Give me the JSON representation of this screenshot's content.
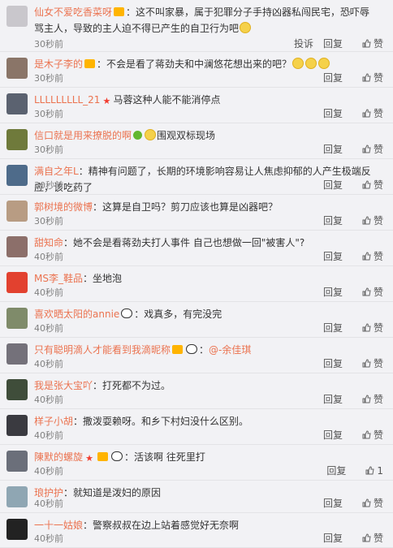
{
  "actions": {
    "report": "投诉",
    "reply": "回复",
    "like": "赞"
  },
  "comments": [
    {
      "name": "仙女不爱吃香菜呀",
      "badges": [
        "vip"
      ],
      "text": "：这不叫家暴，属于犯罪分子手持凶器私闯民宅，恐吓辱骂主人，导致的主人迫不得已产生的自卫行为吧",
      "time": "30秒前",
      "avatar_color": "#c9c7cc"
    },
    {
      "name": "是木子李的",
      "badges": [
        "vip"
      ],
      "text": "：不会是看了蒋劲夫和中澜悠花想出来的吧？",
      "time": "30秒前",
      "avatar_color": "#8a7568"
    },
    {
      "name": "LLLLLLLLL_21",
      "badges": [
        "red"
      ],
      "text": "马蓉这种人能不能消停点",
      "time": "30秒前",
      "avatar_color": "#5b6270"
    },
    {
      "name": "信口就是用来撩脱的啊",
      "badges": [
        "green"
      ],
      "text": "围观双标现场",
      "time": "30秒前",
      "avatar_color": "#6f7a3b"
    },
    {
      "name": "满自之年L",
      "badges": [],
      "text": "：精神有问题了，长期的环境影响容易让人焦虑抑郁的人产生极端反应，该吃药了",
      "time": "30秒前",
      "avatar_color": "#4e6b8a"
    },
    {
      "name": "郭树境的微博",
      "badges": [],
      "text": "：这算是自卫吗？剪刀应该也算是凶器吧？",
      "time": "30秒前",
      "avatar_color": "#b89c83"
    },
    {
      "name": "甜知命",
      "badges": [],
      "text": "：她不会是看蒋劲夫打人事件 自己也想做一回\"被害人\"?",
      "time": "40秒前",
      "avatar_color": "#8c6f6a"
    },
    {
      "name": "MS李_鞋品",
      "badges": [],
      "text": "：坐地泡",
      "time": "40秒前",
      "avatar_color": "#e2412f"
    },
    {
      "name": "喜欢晒太阳的annie",
      "badges": [
        "panda"
      ],
      "text": "：戏真多，有完没完",
      "time": "40秒前",
      "avatar_color": "#7f8b6a"
    },
    {
      "name": "只有聪明滴人才能看到我滴昵称",
      "badges": [
        "vip",
        "panda"
      ],
      "text": "：",
      "mention": "@-余佳琪",
      "time": "40秒前",
      "avatar_color": "#74717a"
    },
    {
      "name": "我是张大宝吖",
      "badges": [],
      "text": "：打死都不为过。",
      "time": "40秒前",
      "avatar_color": "#3f4d3a"
    },
    {
      "name": "样子小胡",
      "badges": [],
      "text": "：撒泼耍赖呀。和乡下村妇没什么区别。",
      "time": "40秒前",
      "avatar_color": "#3a3a40"
    },
    {
      "name": "陳默的螺旋",
      "badges": [
        "red",
        "vip",
        "panda"
      ],
      "text": "：活该啊 往死里打",
      "time": "40秒前",
      "avatar_color": "#6b6f7a",
      "like_count": "1"
    },
    {
      "name": "琅护护",
      "badges": [],
      "text": "：就知道是泼妇的原因",
      "time": "40秒前",
      "avatar_color": "#8fa6b3"
    },
    {
      "name": "一十一姑娘",
      "badges": [],
      "text": "：警察叔叔在边上站着感觉好无奈啊",
      "time": "40秒前",
      "avatar_color": "#222222"
    }
  ]
}
